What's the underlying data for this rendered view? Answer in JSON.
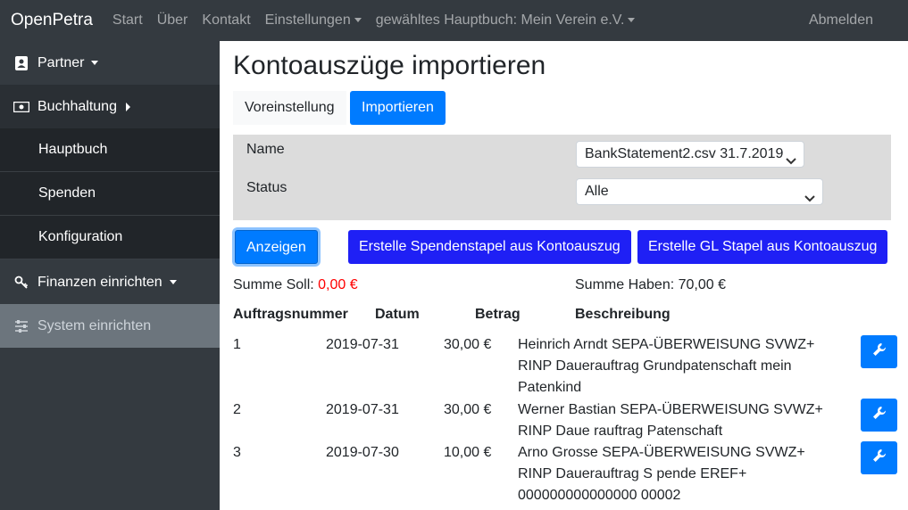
{
  "app": {
    "brand": "OpenPetra"
  },
  "navbar": {
    "links": [
      "Start",
      "Über",
      "Kontakt",
      "Einstellungen",
      "gewähltes Hauptbuch: Mein Verein e.V."
    ],
    "logout": "Abmelden"
  },
  "sidebar": {
    "partner": "Partner",
    "buchhaltung": "Buchhaltung",
    "hauptbuch": "Hauptbuch",
    "spenden": "Spenden",
    "konfiguration": "Konfiguration",
    "finanzen": "Finanzen einrichten",
    "system": "System einrichten"
  },
  "page": {
    "title": "Kontoauszüge importieren",
    "tabs": [
      "Voreinstellung",
      "Importieren"
    ]
  },
  "filter": {
    "name_label": "Name",
    "name_value": "BankStatement2.csv 31.7.2019",
    "status_label": "Status",
    "status_value": "Alle"
  },
  "actions": {
    "show": "Anzeigen",
    "create_donation": "Erstelle Spendenstapel aus Kontoauszug",
    "create_gl": "Erstelle GL Stapel aus Kontoauszug"
  },
  "summary": {
    "soll_label": "Summe Soll:",
    "soll_value": "0,00 €",
    "haben": "Summe Haben: 70,00 €"
  },
  "table": {
    "headers": [
      "Auftragsnummer",
      "Datum",
      "Betrag",
      "Beschreibung"
    ],
    "rows": [
      {
        "nr": "1",
        "date": "2019-07-31",
        "amount": "30,00 €",
        "desc": "Heinrich Arndt SEPA-ÜBERWEISUNG SVWZ+ RINP Dauerauftrag Grundpatenschaft mein Patenkind"
      },
      {
        "nr": "2",
        "date": "2019-07-31",
        "amount": "30,00 €",
        "desc": "Werner Bastian SEPA-ÜBERWEISUNG SVWZ+ RINP Daue rauftrag Patenschaft"
      },
      {
        "nr": "3",
        "date": "2019-07-30",
        "amount": "10,00 €",
        "desc": "Arno Grosse SEPA-ÜBERWEISUNG SVWZ+ RINP Dauerauftrag S pende EREF+ 000000000000000 00002"
      }
    ]
  },
  "icons": {
    "partner": "address-book-icon",
    "buchhaltung": "money-bill-icon",
    "finanzen": "keys-icon",
    "system": "sliders-icon",
    "row_edit": "wrench-icon"
  }
}
